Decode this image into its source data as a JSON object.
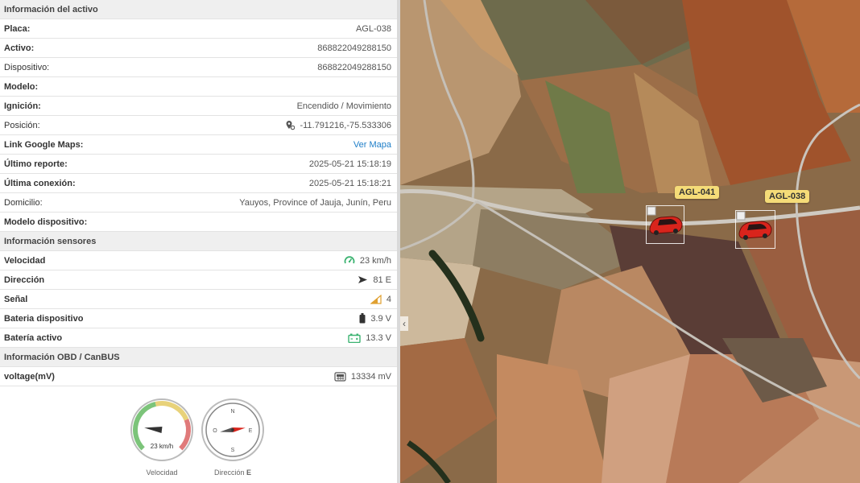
{
  "activo": {
    "section_title": "Información del activo",
    "rows": [
      {
        "label": "Placa:",
        "value": "AGL-038"
      },
      {
        "label": "Activo:",
        "value": "868822049288150"
      },
      {
        "label": "Dispositivo:",
        "value": "868822049288150"
      },
      {
        "label": "Modelo:",
        "value": ""
      },
      {
        "label": "Ignición:",
        "value": "Encendido / Movimiento"
      },
      {
        "label": "Posición:",
        "value": "-11.791216,-75.533306"
      },
      {
        "label": "Link Google Maps:",
        "value": "Ver Mapa"
      },
      {
        "label": "Último reporte:",
        "value": "2025-05-21 15:18:19"
      },
      {
        "label": "Última conexión:",
        "value": "2025-05-21 15:18:21"
      },
      {
        "label": "Domicilio:",
        "value": "Yauyos, Province of Jauja, Junín, Peru"
      },
      {
        "label": "Modelo dispositivo:",
        "value": ""
      }
    ]
  },
  "sensores": {
    "section_title": "Información sensores",
    "rows": [
      {
        "label": "Velocidad",
        "value": "23 km/h",
        "icon": "speedometer-icon"
      },
      {
        "label": "Dirección",
        "value": "81 E",
        "icon": "direction-arrow-icon"
      },
      {
        "label": "Señal",
        "value": "4",
        "icon": "signal-icon"
      },
      {
        "label": "Bateria dispositivo",
        "value": "3.9 V",
        "icon": "battery-icon"
      },
      {
        "label": "Batería activo",
        "value": "13.3 V",
        "icon": "car-battery-icon"
      }
    ]
  },
  "obd": {
    "section_title": "Información OBD / CanBUS",
    "rows": [
      {
        "label": "voltage(mV)",
        "value": "13334 mV",
        "icon": "obd-icon"
      }
    ]
  },
  "gauges": {
    "speed": {
      "value": 23,
      "display": "23 km/h",
      "label": "Velocidad",
      "max": 120
    },
    "direction": {
      "degrees": 81,
      "label": "Dirección",
      "label_suffix": "E",
      "n": "N",
      "s": "S",
      "e": "E",
      "o": "O"
    }
  },
  "map": {
    "vehicles": [
      {
        "plate": "AGL-041"
      },
      {
        "plate": "AGL-038"
      }
    ],
    "collapse_icon": "chevron-left-icon"
  },
  "colors": {
    "accent": "#1e7ec8",
    "green": "#3cb371",
    "car": "#d9241c",
    "tag": "#f5dc78"
  }
}
